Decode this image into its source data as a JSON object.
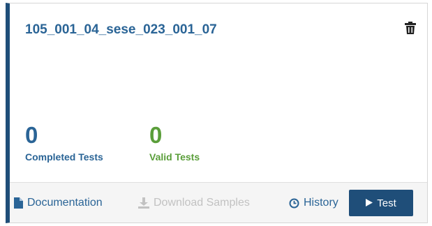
{
  "card": {
    "title": "105_001_04_sese_023_001_07",
    "delete_icon": "trash-icon"
  },
  "stats": {
    "completed": {
      "value": "0",
      "label": "Completed Tests",
      "color": "#2a6496"
    },
    "valid": {
      "value": "0",
      "label": "Valid Tests",
      "color": "#5a9e3a"
    }
  },
  "footer": {
    "documentation": {
      "label": "Documentation",
      "icon": "document-icon"
    },
    "download_samples": {
      "label": "Download Samples",
      "icon": "download-icon",
      "disabled": true
    },
    "history": {
      "label": "History",
      "icon": "clock-icon"
    },
    "test_button": {
      "label": "Test",
      "icon": "play-icon"
    }
  },
  "colors": {
    "accent": "#1f4e79",
    "link": "#2a6496",
    "success": "#5a9e3a",
    "disabled": "#c2c2c2"
  }
}
